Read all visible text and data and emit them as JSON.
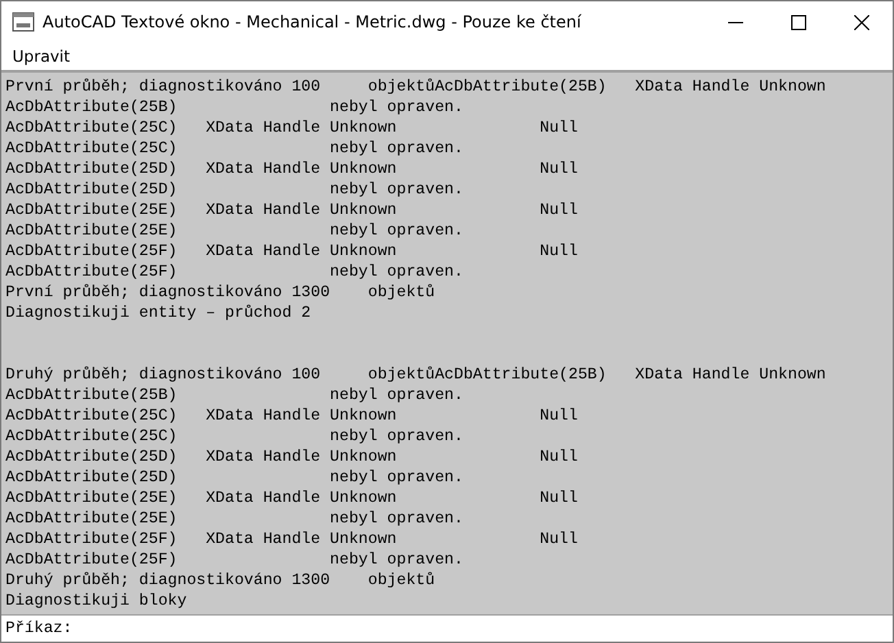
{
  "window": {
    "title": "AutoCAD Textové okno - Mechanical - Metric.dwg - Pouze ke čtení"
  },
  "menu": [
    "Upravit"
  ],
  "output": [
    {
      "lines": [
        "První průběh; diagnostikováno 100     objektůAcDbAttribute(25B)   XData Handle Unknown",
        "AcDbAttribute(25B)                nebyl opraven.",
        "AcDbAttribute(25C)   XData Handle Unknown               Null",
        "AcDbAttribute(25C)                nebyl opraven.",
        "AcDbAttribute(25D)   XData Handle Unknown               Null",
        "AcDbAttribute(25D)                nebyl opraven.",
        "AcDbAttribute(25E)   XData Handle Unknown               Null",
        "AcDbAttribute(25E)                nebyl opraven.",
        "AcDbAttribute(25F)   XData Handle Unknown               Null",
        "AcDbAttribute(25F)                nebyl opraven.",
        "První průběh; diagnostikováno 1300    objektů",
        "Diagnostikuji entity – průchod 2"
      ]
    },
    {
      "lines": [
        "Druhý průběh; diagnostikováno 100     objektůAcDbAttribute(25B)   XData Handle Unknown",
        "AcDbAttribute(25B)                nebyl opraven.",
        "AcDbAttribute(25C)   XData Handle Unknown               Null",
        "AcDbAttribute(25C)                nebyl opraven.",
        "AcDbAttribute(25D)   XData Handle Unknown               Null",
        "AcDbAttribute(25D)                nebyl opraven.",
        "AcDbAttribute(25E)   XData Handle Unknown               Null",
        "AcDbAttribute(25E)                nebyl opraven.",
        "AcDbAttribute(25F)   XData Handle Unknown               Null",
        "AcDbAttribute(25F)                nebyl opraven.",
        "Druhý průběh; diagnostikováno 1300    objektů",
        "Diagnostikuji bloky"
      ]
    }
  ],
  "command": {
    "prompt": "Příkaz:"
  }
}
